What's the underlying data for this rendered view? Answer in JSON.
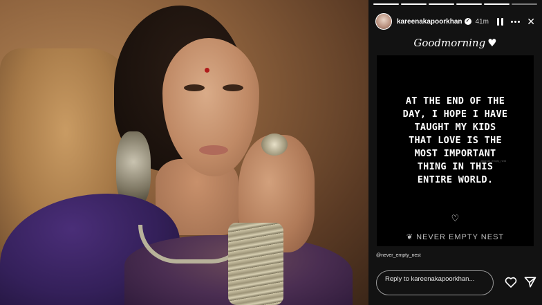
{
  "story": {
    "username": "kareenakapoorkhan",
    "time_ago": "41m",
    "progress_segments": [
      {
        "state": "done"
      },
      {
        "state": "done"
      },
      {
        "state": "done"
      },
      {
        "state": "done"
      },
      {
        "state": "done"
      },
      {
        "state": "active"
      }
    ],
    "greeting": "Goodmorning",
    "quote": "AT THE END OF THE\nDAY, I HOPE I HAVE\nTAUGHT MY KIDS\nTHAT LOVE IS THE\nMOST IMPORTANT\nTHING IN THIS\nENTIRE WORLD.",
    "watermark": "@never_empty_nest",
    "brand": "NEVER EMPTY NEST",
    "mention": "@never_empty_nest",
    "reply_placeholder": "Reply to kareenakapoorkhan...",
    "icons": [
      "pause-icon",
      "more-icon",
      "close-icon",
      "heart-icon",
      "leaf-icon",
      "like-icon",
      "share-icon"
    ]
  },
  "colors": {
    "story_background": "#121212",
    "card_background": "#000000",
    "text": "#ffffff"
  }
}
